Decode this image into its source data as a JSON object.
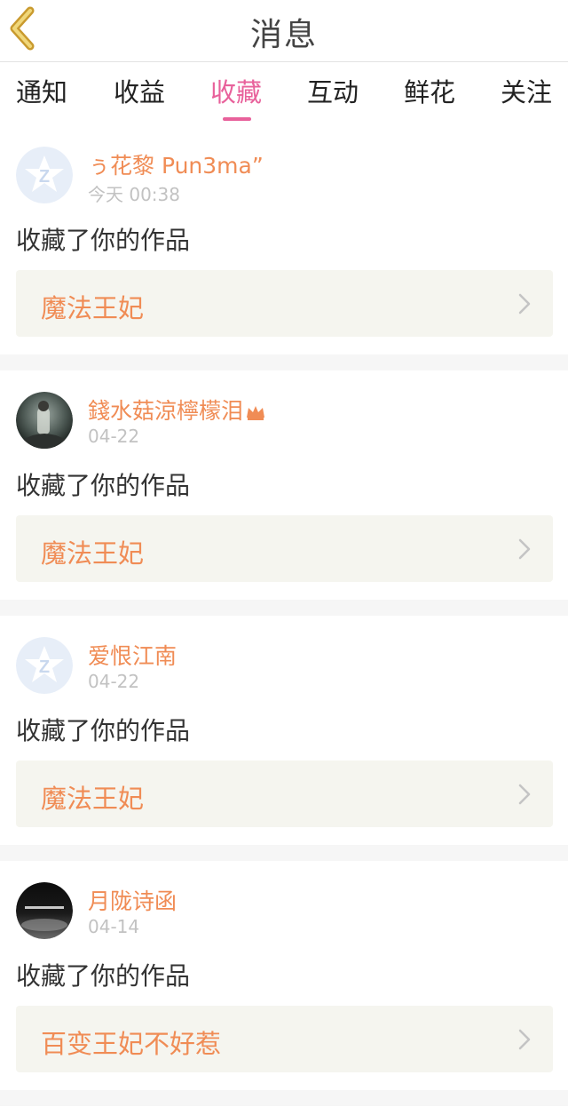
{
  "header": {
    "title": "消息",
    "accent_color": "#e8619b",
    "back_icon_color": "#e3b04a"
  },
  "tabs": [
    {
      "label": "通知"
    },
    {
      "label": "收益"
    },
    {
      "label": "收藏",
      "active": true
    },
    {
      "label": "互动"
    },
    {
      "label": "鲜花"
    },
    {
      "label": "关注"
    }
  ],
  "messages": [
    {
      "username": "ぅ花黎 Pun3ma”",
      "time": "今天 00:38",
      "action": "收藏了你的作品",
      "work_title": "魔法王妃",
      "avatar": "default-avatar-icon"
    },
    {
      "username": "錢水菇涼檸檬泪",
      "time": "04-22",
      "action": "收藏了你的作品",
      "work_title": "魔法王妃",
      "avatar": "photo-avatar",
      "badge": "crown-icon"
    },
    {
      "username": "爱恨江南",
      "time": "04-22",
      "action": "收藏了你的作品",
      "work_title": "魔法王妃",
      "avatar": "default-avatar-icon"
    },
    {
      "username": "月陇诗函",
      "time": "04-14",
      "action": "收藏了你的作品",
      "work_title": "百变王妃不好惹",
      "avatar": "photo-avatar-dark"
    }
  ]
}
